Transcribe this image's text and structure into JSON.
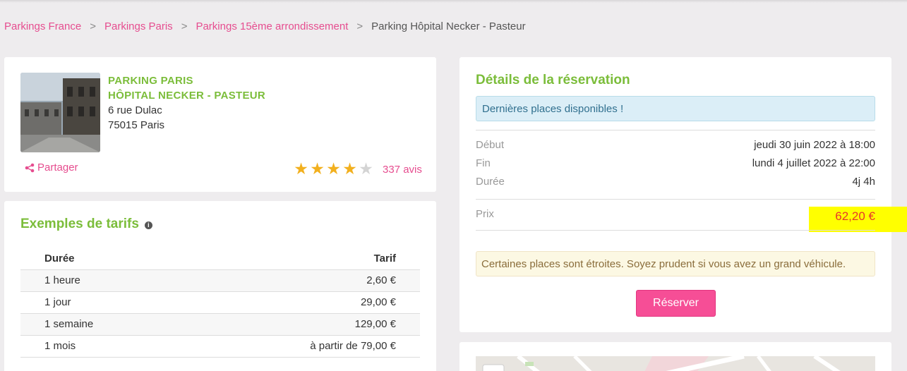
{
  "breadcrumb": {
    "items": [
      "Parkings France",
      "Parkings Paris",
      "Parkings 15ème arrondissement"
    ],
    "current": "Parking Hôpital Necker - Pasteur",
    "separator": ">"
  },
  "parking": {
    "name_line1": "PARKING PARIS",
    "name_line2": "HÔPITAL NECKER - PASTEUR",
    "address_line1": "6 rue Dulac",
    "address_line2": "75015 Paris",
    "share_label": "Partager",
    "rating_stars": 4,
    "rating_max": 5,
    "reviews": "337 avis"
  },
  "tarifs": {
    "title": "Exemples de tarifs",
    "headers": {
      "duration": "Durée",
      "price": "Tarif"
    },
    "rows": [
      {
        "duration": "1 heure",
        "price": "2,60 €"
      },
      {
        "duration": "1 jour",
        "price": "29,00 €"
      },
      {
        "duration": "1 semaine",
        "price": "129,00 €"
      },
      {
        "duration": "1 mois",
        "price": "à partir de 79,00 €"
      }
    ]
  },
  "reservation": {
    "title": "Détails de la réservation",
    "info_alert": "Dernières places disponibles !",
    "start_label": "Début",
    "start_value": "jeudi 30 juin 2022 à 18:00",
    "end_label": "Fin",
    "end_value": "lundi 4 juillet 2022 à 22:00",
    "duration_label": "Durée",
    "duration_value": "4j 4h",
    "price_label": "Prix",
    "price_value": "62,20 €",
    "warning": "Certaines places sont étroites. Soyez prudent si vous avez un grand véhicule.",
    "reserve_button": "Réserver"
  },
  "colors": {
    "accent_pink": "#e64d8f",
    "title_green": "#7bbd3a",
    "price_red": "#e8362b",
    "highlight_yellow": "#ffff00"
  }
}
